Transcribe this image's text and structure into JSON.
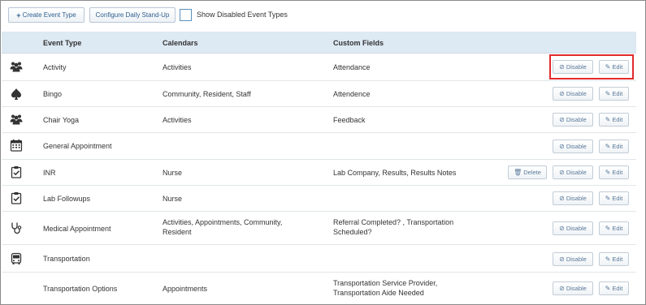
{
  "toolbar": {
    "create_label": "Create Event Type",
    "configure_label": "Configure Daily Stand-Up",
    "show_disabled_label": "Show Disabled Event Types"
  },
  "table": {
    "headers": {
      "event_type": "Event Type",
      "calendars": "Calendars",
      "custom_fields": "Custom Fields"
    },
    "action_labels": {
      "disable": "Disable",
      "edit": "Edit",
      "delete": "Delete"
    },
    "rows": [
      {
        "icon": "group-icon",
        "name": "Activity",
        "calendars": "Activities",
        "custom_fields": "Attendance"
      },
      {
        "icon": "spade-icon",
        "name": "Bingo",
        "calendars": "Community, Resident, Staff",
        "custom_fields": "Attendence"
      },
      {
        "icon": "group-icon",
        "name": "Chair Yoga",
        "calendars": "Activities",
        "custom_fields": "Feedback"
      },
      {
        "icon": "calendar-icon",
        "name": "General Appointment",
        "calendars": "",
        "custom_fields": ""
      },
      {
        "icon": "clipboard-check-icon",
        "name": "INR",
        "calendars": "Nurse",
        "custom_fields": "Lab Company, Results, Results Notes",
        "has_delete": true
      },
      {
        "icon": "clipboard-check-icon",
        "name": "Lab Followups",
        "calendars": "Nurse",
        "custom_fields": ""
      },
      {
        "icon": "stethoscope-icon",
        "name": "Medical Appointment",
        "calendars": "Activities, Appointments, Community, Resident",
        "custom_fields": "Referral Completed? , Transportation Scheduled?"
      },
      {
        "icon": "bus-icon",
        "name": "Transportation",
        "calendars": "",
        "custom_fields": ""
      },
      {
        "icon": "",
        "name": "Transportation Options",
        "calendars": "Appointments",
        "custom_fields": "Transportation Service Provider, Transportation Aide Needed"
      }
    ]
  },
  "colors": {
    "header_bg": "#dde9f3",
    "highlight": "#e22b2b",
    "checkbox_border": "#5a8fbf",
    "button_text": "#2f5f8f"
  }
}
